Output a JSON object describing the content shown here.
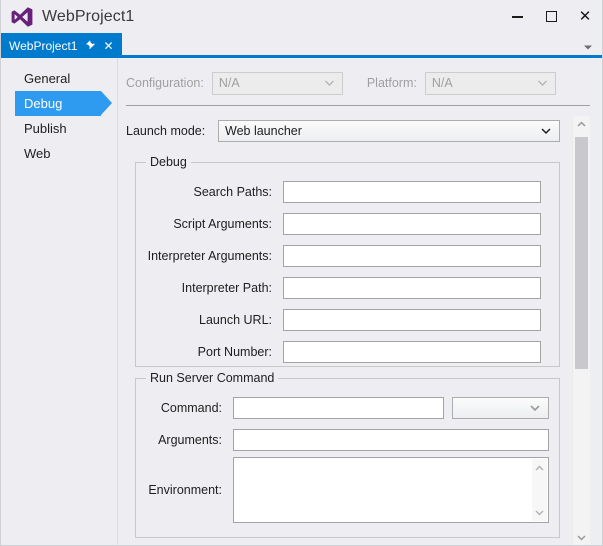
{
  "window": {
    "title": "WebProject1",
    "logo_icon": "visual-studio-logo",
    "controls": {
      "minimize": "minimize-icon",
      "maximize": "maximize-icon",
      "close": "close-icon"
    }
  },
  "tabstrip": {
    "active_tab": "WebProject1",
    "pin_icon": "pin-icon",
    "close_icon": "close-icon",
    "overflow_icon": "chevron-down-icon"
  },
  "sidebar": {
    "items": [
      {
        "label": "General",
        "selected": false
      },
      {
        "label": "Debug",
        "selected": true
      },
      {
        "label": "Publish",
        "selected": false
      },
      {
        "label": "Web",
        "selected": false
      }
    ]
  },
  "toolbar": {
    "configuration_label": "Configuration:",
    "configuration_value": "N/A",
    "platform_label": "Platform:",
    "platform_value": "N/A",
    "chevron_icon": "chevron-down-icon"
  },
  "launch": {
    "label": "Launch mode:",
    "value": "Web launcher",
    "chevron_icon": "chevron-down-icon"
  },
  "debug_group": {
    "title": "Debug",
    "fields": [
      {
        "label": "Search Paths:",
        "value": "",
        "name": "search-paths"
      },
      {
        "label": "Script Arguments:",
        "value": "",
        "name": "script-arguments"
      },
      {
        "label": "Interpreter Arguments:",
        "value": "",
        "name": "interpreter-arguments"
      },
      {
        "label": "Interpreter Path:",
        "value": "",
        "name": "interpreter-path"
      },
      {
        "label": "Launch URL:",
        "value": "",
        "name": "launch-url"
      },
      {
        "label": "Port Number:",
        "value": "",
        "name": "port-number"
      }
    ]
  },
  "run_server_group": {
    "title": "Run Server Command",
    "command_label": "Command:",
    "command_value": "",
    "command_combo_value": "",
    "command_combo_chevron": "chevron-down-icon",
    "arguments_label": "Arguments:",
    "arguments_value": "",
    "environment_label": "Environment:",
    "environment_value": "",
    "env_scroll_up_icon": "chevron-up-icon",
    "env_scroll_down_icon": "chevron-down-icon"
  },
  "scrollbar": {
    "up_icon": "chevron-up-icon",
    "down_icon": "chevron-down-icon"
  },
  "colors": {
    "accent_tab": "#007acc",
    "accent_selection": "#2e9bf0",
    "window_bg": "#eeeef2",
    "logo_purple": "#68217a"
  }
}
